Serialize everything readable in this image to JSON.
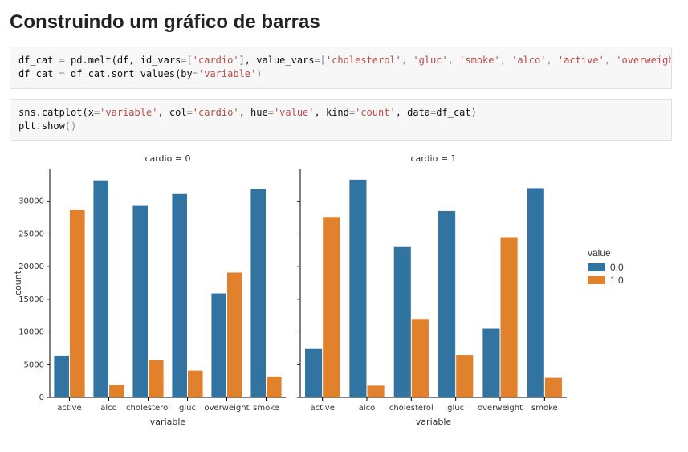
{
  "title": "Construindo um gráfico de barras",
  "code_cells": [
    [
      [
        {
          "t": "df_cat ",
          "c": "tok-id"
        },
        {
          "t": "= ",
          "c": "tok-op"
        },
        {
          "t": "pd.melt",
          "c": "tok-call"
        },
        {
          "t": "(df, id_vars",
          "c": "tok-id"
        },
        {
          "t": "=",
          "c": "tok-op"
        },
        {
          "t": "[",
          "c": "tok-op"
        },
        {
          "t": "'cardio'",
          "c": "tok-str"
        },
        {
          "t": "], value_vars",
          "c": "tok-id"
        },
        {
          "t": "=",
          "c": "tok-op"
        },
        {
          "t": "[",
          "c": "tok-op"
        },
        {
          "t": "'cholesterol'",
          "c": "tok-str"
        },
        {
          "t": ", ",
          "c": "tok-op"
        },
        {
          "t": "'gluc'",
          "c": "tok-str"
        },
        {
          "t": ", ",
          "c": "tok-op"
        },
        {
          "t": "'smoke'",
          "c": "tok-str"
        },
        {
          "t": ", ",
          "c": "tok-op"
        },
        {
          "t": "'alco'",
          "c": "tok-str"
        },
        {
          "t": ", ",
          "c": "tok-op"
        },
        {
          "t": "'active'",
          "c": "tok-str"
        },
        {
          "t": ", ",
          "c": "tok-op"
        },
        {
          "t": "'overweight'",
          "c": "tok-str"
        },
        {
          "t": "])",
          "c": "tok-op"
        }
      ],
      [
        {
          "t": "df_cat ",
          "c": "tok-id"
        },
        {
          "t": "= ",
          "c": "tok-op"
        },
        {
          "t": "df_cat.sort_values",
          "c": "tok-call"
        },
        {
          "t": "(by",
          "c": "tok-id"
        },
        {
          "t": "=",
          "c": "tok-op"
        },
        {
          "t": "'variable'",
          "c": "tok-str"
        },
        {
          "t": ")",
          "c": "tok-op"
        }
      ]
    ],
    [
      [
        {
          "t": "sns.catplot",
          "c": "tok-call"
        },
        {
          "t": "(x",
          "c": "tok-id"
        },
        {
          "t": "=",
          "c": "tok-op"
        },
        {
          "t": "'variable'",
          "c": "tok-str"
        },
        {
          "t": ", col",
          "c": "tok-id"
        },
        {
          "t": "=",
          "c": "tok-op"
        },
        {
          "t": "'cardio'",
          "c": "tok-str"
        },
        {
          "t": ", hue",
          "c": "tok-id"
        },
        {
          "t": "=",
          "c": "tok-op"
        },
        {
          "t": "'value'",
          "c": "tok-str"
        },
        {
          "t": ", kind",
          "c": "tok-id"
        },
        {
          "t": "=",
          "c": "tok-op"
        },
        {
          "t": "'count'",
          "c": "tok-str"
        },
        {
          "t": ", data",
          "c": "tok-id"
        },
        {
          "t": "=",
          "c": "tok-op"
        },
        {
          "t": "df_cat)",
          "c": "tok-id"
        }
      ],
      [
        {
          "t": "plt.show",
          "c": "tok-call"
        },
        {
          "t": "()",
          "c": "tok-op"
        }
      ]
    ]
  ],
  "legend": {
    "title": "value",
    "items": [
      {
        "label": "0.0",
        "color": "#3274a1"
      },
      {
        "label": "1.0",
        "color": "#e1812b"
      }
    ]
  },
  "chart_data": {
    "type": "bar",
    "ylabel": "count",
    "xlabel": "variable",
    "ylim": [
      0,
      35000
    ],
    "yticks": [
      0,
      5000,
      10000,
      15000,
      20000,
      25000,
      30000
    ],
    "categories": [
      "active",
      "alco",
      "cholesterol",
      "gluc",
      "overweight",
      "smoke"
    ],
    "legend_title": "value",
    "legend_labels": [
      "0.0",
      "1.0"
    ],
    "facets": [
      {
        "title": "cardio = 0",
        "series": [
          {
            "name": "0.0",
            "color": "#3274a1",
            "values": [
              6400,
              33200,
              29400,
              31100,
              15900,
              31900
            ]
          },
          {
            "name": "1.0",
            "color": "#e1812b",
            "values": [
              28700,
              1900,
              5700,
              4100,
              19100,
              3200
            ]
          }
        ]
      },
      {
        "title": "cardio = 1",
        "series": [
          {
            "name": "0.0",
            "color": "#3274a1",
            "values": [
              7400,
              33300,
              23000,
              28500,
              10500,
              32000
            ]
          },
          {
            "name": "1.0",
            "color": "#e1812b",
            "values": [
              27600,
              1800,
              12000,
              6500,
              24500,
              3000
            ]
          }
        ]
      }
    ]
  }
}
